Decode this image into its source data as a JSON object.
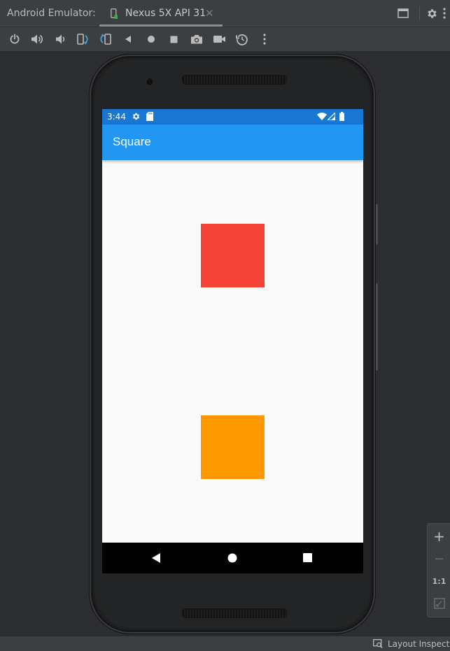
{
  "window": {
    "panel_title": "Android Emulator:",
    "tab_label": "Nexus 5X API 31",
    "tab_close": "✕"
  },
  "toolbar": {
    "buttons": [
      {
        "name": "power-button",
        "icon": "power-icon"
      },
      {
        "name": "volume-up-button",
        "icon": "volume-up-icon"
      },
      {
        "name": "volume-down-button",
        "icon": "volume-down-icon"
      },
      {
        "name": "rotate-left-button",
        "icon": "rotate-left-icon"
      },
      {
        "name": "rotate-right-button",
        "icon": "rotate-right-icon"
      },
      {
        "name": "back-button",
        "icon": "back-triangle-icon"
      },
      {
        "name": "home-button",
        "icon": "home-circle-icon"
      },
      {
        "name": "overview-button",
        "icon": "overview-square-icon"
      },
      {
        "name": "screenshot-button",
        "icon": "camera-icon"
      },
      {
        "name": "screen-record-button",
        "icon": "video-camera-icon"
      },
      {
        "name": "snapshots-button",
        "icon": "snapshot-history-icon"
      },
      {
        "name": "more-options-button",
        "icon": "more-vertical-icon"
      }
    ]
  },
  "device": {
    "status_bar": {
      "time": "3:44",
      "color": "#1976d2"
    },
    "app_bar": {
      "title": "Square",
      "color": "#2196f3"
    },
    "content": {
      "background": "#fafafa",
      "squares": [
        {
          "name": "red-square",
          "color": "#f44336"
        },
        {
          "name": "orange-square",
          "color": "#ff9800"
        }
      ]
    }
  },
  "zoom_controls": {
    "zoom_in": "+",
    "zoom_out": "−",
    "actual_size": "1:1"
  },
  "status_bar_bottom": {
    "layout_inspector": "Layout Inspector"
  }
}
